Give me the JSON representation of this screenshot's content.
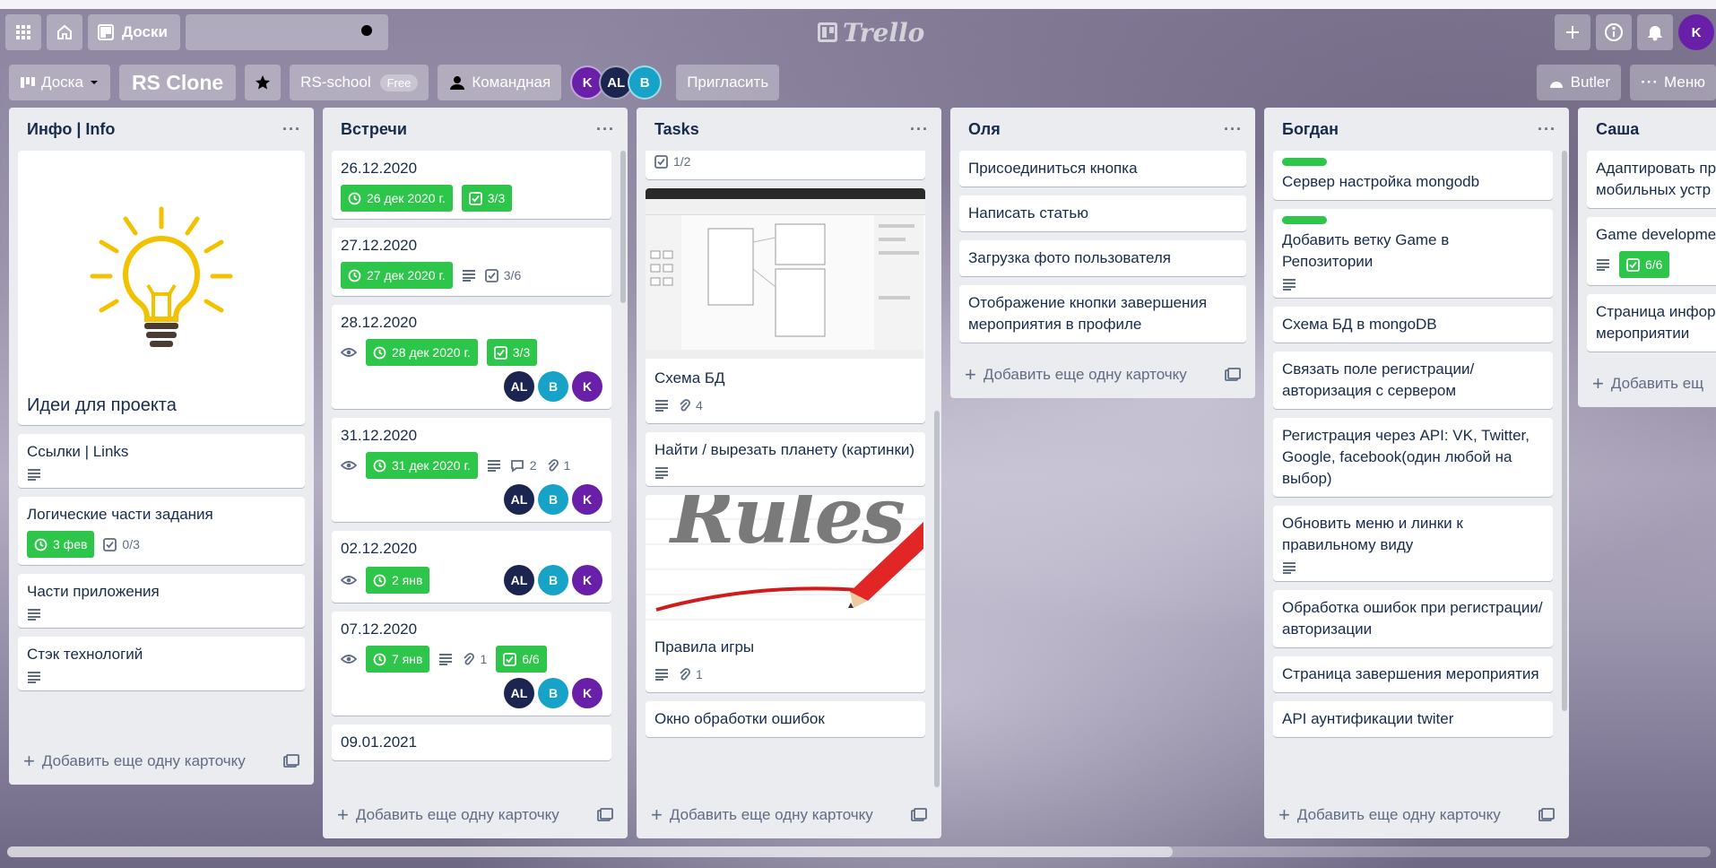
{
  "topbar": {
    "boards_label": "Доски",
    "logo": "Trello",
    "user_initial": "K"
  },
  "board": {
    "view_label": "Доска",
    "title": "RS Clone",
    "team": "RS-school",
    "plan": "Free",
    "visibility": "Командная",
    "members": [
      "K",
      "AL",
      "B"
    ],
    "invite_label": "Пригласить",
    "butler_label": "Butler",
    "menu_label": "Меню"
  },
  "colors": {
    "green": "#2dc54a",
    "avatar_k": "#6a1fa8",
    "avatar_al": "#1c2550",
    "avatar_b": "#16a3c7"
  },
  "add_card_label": "Добавить еще одну карточку",
  "lists": [
    {
      "title": "Инфо | Info",
      "cards": [
        {
          "title": "Идеи для проекта",
          "cover": "lightbulb-icon"
        },
        {
          "title": "Ссылки | Links",
          "description": true
        },
        {
          "title": "Логические части задания",
          "due": "3 фев",
          "checklist": "0/3"
        },
        {
          "title": "Части приложения",
          "description": true
        },
        {
          "title": "Стэк технологий",
          "description": true
        }
      ]
    },
    {
      "title": "Встречи",
      "cards": [
        {
          "title": "26.12.2020",
          "due": "26 дек 2020 г.",
          "checklist": "3/3"
        },
        {
          "title": "27.12.2020",
          "due": "27 дек 2020 г.",
          "description": true,
          "checklist": "3/6"
        },
        {
          "title": "28.12.2020",
          "watch": true,
          "due": "28 дек 2020 г.",
          "checklist": "3/3",
          "members": [
            "AL",
            "B",
            "K"
          ]
        },
        {
          "title": "31.12.2020",
          "watch": true,
          "due": "31 дек 2020 г.",
          "description": true,
          "comments": "2",
          "attachments": "1",
          "members": [
            "AL",
            "B",
            "K"
          ]
        },
        {
          "title": "02.12.2020",
          "watch": true,
          "due": "2 янв",
          "members": [
            "AL",
            "B",
            "K"
          ]
        },
        {
          "title": "07.12.2020",
          "watch": true,
          "due": "7 янв",
          "description": true,
          "attachments": "1",
          "checklist": "6/6",
          "members": [
            "AL",
            "B",
            "K"
          ]
        },
        {
          "title": "09.01.2021"
        }
      ]
    },
    {
      "title": "Tasks",
      "cards": [
        {
          "checklist": "1/2"
        },
        {
          "title": "Схема БД",
          "cover": "db-schema-screenshot",
          "description": true,
          "attachments": "4"
        },
        {
          "title": "Найти / вырезать планету (картинки)",
          "description": true
        },
        {
          "title": "Правила игры",
          "cover": "rules-image",
          "cover_text": "Rules",
          "description": true,
          "attachments": "1"
        },
        {
          "title": "Окно обработки ошибок"
        }
      ]
    },
    {
      "title": "Оля",
      "cards": [
        {
          "title": "Присоединиться кнопка"
        },
        {
          "title": "Написать статью"
        },
        {
          "title": "Загрузка фото пользователя"
        },
        {
          "title": "Отображение кнопки завершения мероприятия в профиле"
        }
      ]
    },
    {
      "title": "Богдан",
      "cards": [
        {
          "title": "Сервер настройка mongodb",
          "label": "green"
        },
        {
          "title": "Добавить ветку Game в Репозитории",
          "label": "green",
          "description": true
        },
        {
          "title": "Схема БД в mongoDB"
        },
        {
          "title": "Связать поле регистрации/авторизация с сервером"
        },
        {
          "title": "Регистрация через API: VK, Twitter, Google, facebook(один любой на выбор)"
        },
        {
          "title": "Обновить меню и линки к правильному виду",
          "description": true
        },
        {
          "title": "Обработка ошибок при регистрации/авторизации"
        },
        {
          "title": "Страница завершения мероприятия"
        },
        {
          "title": "API аунтификации twiter"
        }
      ]
    },
    {
      "title": "Саша",
      "cards": [
        {
          "title": "Адаптировать пр мобильных устр"
        },
        {
          "title": "Game developme",
          "description": true,
          "checklist": "6/6"
        },
        {
          "title": "Страница инфор мероприятии"
        }
      ],
      "add_card_label": "Добавить ещ"
    }
  ]
}
